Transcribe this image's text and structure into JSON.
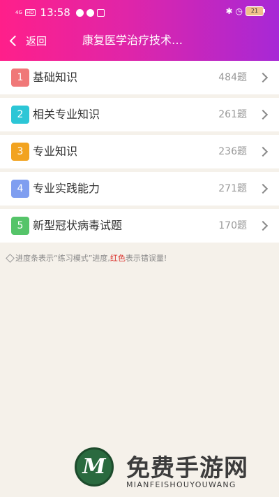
{
  "status_bar": {
    "network": "4G",
    "hd": "HD",
    "time": "13:58",
    "battery": "21",
    "bluetooth_icon": "bluetooth-icon",
    "alarm_icon": "alarm-icon"
  },
  "header": {
    "back_label": "返回",
    "title": "康复医学治疗技术…"
  },
  "categories": [
    {
      "index": "1",
      "label": "基础知识",
      "count": "484题",
      "color": "#f07878"
    },
    {
      "index": "2",
      "label": "相关专业知识",
      "count": "261题",
      "color": "#2cc6d6"
    },
    {
      "index": "3",
      "label": "专业知识",
      "count": "236题",
      "color": "#f2a320"
    },
    {
      "index": "4",
      "label": "专业实践能力",
      "count": "271题",
      "color": "#7f9ef0"
    },
    {
      "index": "5",
      "label": "新型冠状病毒试题",
      "count": "170题",
      "color": "#55c469"
    }
  ],
  "note": {
    "part1": "进度条表示“练习模式”进度,",
    "red": "红色",
    "part2": "表示错误量!"
  },
  "watermark": {
    "logo_letter": "M",
    "title": "免费手游网",
    "subtitle": "MIANFEISHOUYOUWANG"
  },
  "colors": {
    "header_gradient_start": "#ff1f8a",
    "header_gradient_end": "#a728d6",
    "background": "#f5f1ea"
  }
}
